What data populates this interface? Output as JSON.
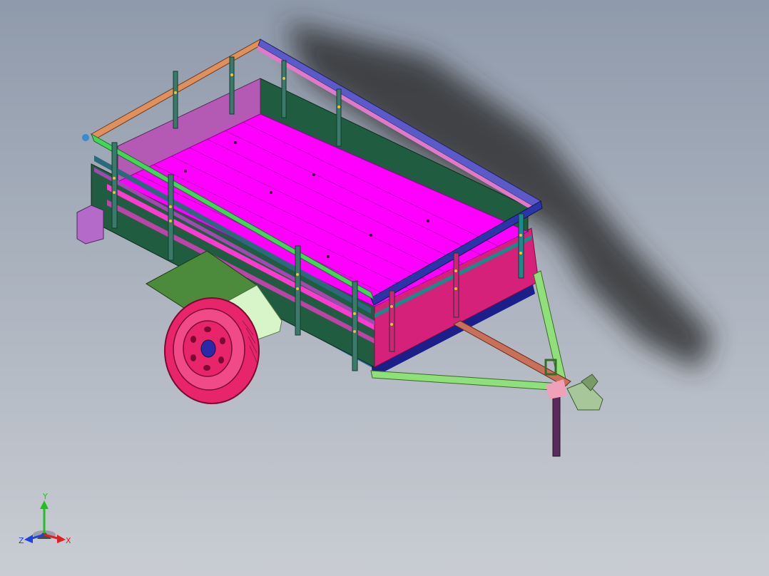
{
  "viewport": {
    "background_top": "#8f9aab",
    "background_bottom": "#c9cdd3"
  },
  "model": {
    "type": "utility trailer assembly",
    "colors": {
      "bed_floor": "#ff00ff",
      "side_panel": "#1f5c40",
      "front_panel": "#d6217a",
      "rail_top_left": "#44d659",
      "rail_top_right": "#2a35a8",
      "wheel": "#e8246b",
      "fender": "#4c8a3c",
      "drawbar": "#8fe07a",
      "tongue_tube": "#c8705a"
    }
  },
  "triad": {
    "x_label": "X",
    "y_label": "Y",
    "z_label": "Z",
    "x_color": "#e02020",
    "y_color": "#20c020",
    "z_color": "#2040e0"
  }
}
